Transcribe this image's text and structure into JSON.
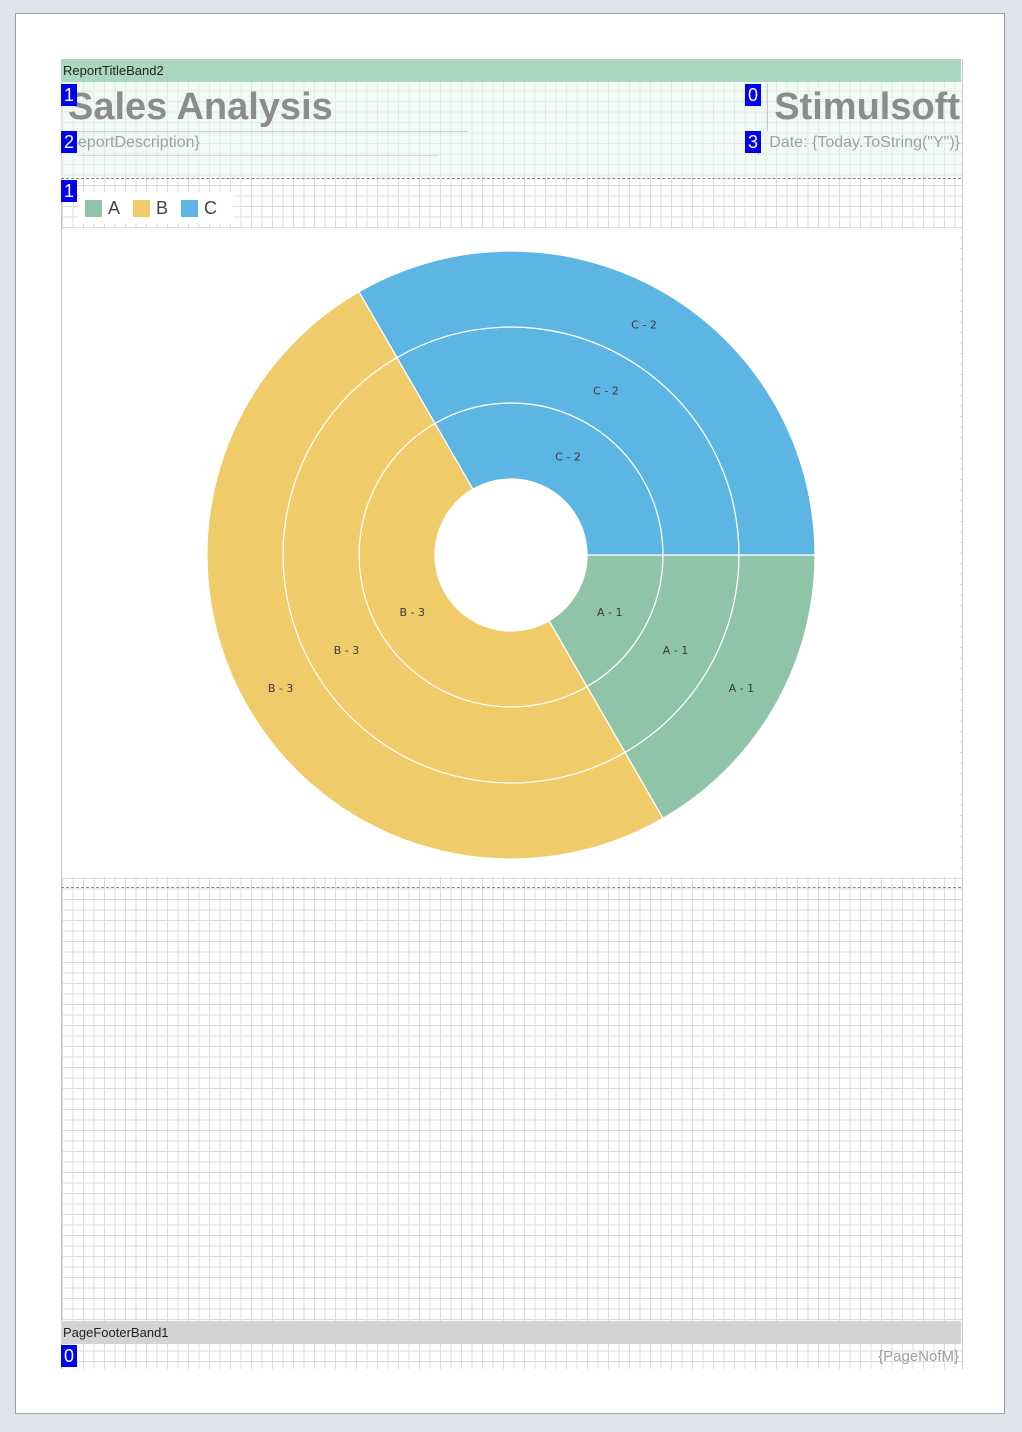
{
  "bands": {
    "title_band_name": "ReportTitleBand2",
    "footer_band_name": "PageFooterBand1"
  },
  "title": {
    "report_title": "Sales Analysis",
    "company": "Stimulsoft",
    "description": "eportDescription}",
    "date": "Date: {Today.ToString(\"Y\")}"
  },
  "badges": {
    "title_left": "1",
    "title_right": "0",
    "desc_left": "2",
    "date_left": "3",
    "chart_left": "1",
    "footer_left": "0"
  },
  "footer": {
    "page_nofm": "{PageNofM}"
  },
  "colors": {
    "A": "#8fc4a8",
    "B": "#efcb6a",
    "C": "#5db5e3"
  },
  "chart_data": {
    "type": "sunburst",
    "legend": [
      "A",
      "B",
      "C"
    ],
    "rings": 3,
    "series": [
      {
        "name": "A",
        "value": 1,
        "labels": [
          "A - 1",
          "A - 1",
          "A - 1"
        ]
      },
      {
        "name": "B",
        "value": 3,
        "labels": [
          "B - 3",
          "B - 3",
          "B - 3"
        ]
      },
      {
        "name": "C",
        "value": 2,
        "labels": [
          "C - 2",
          "C - 2",
          "C - 2"
        ]
      }
    ]
  }
}
